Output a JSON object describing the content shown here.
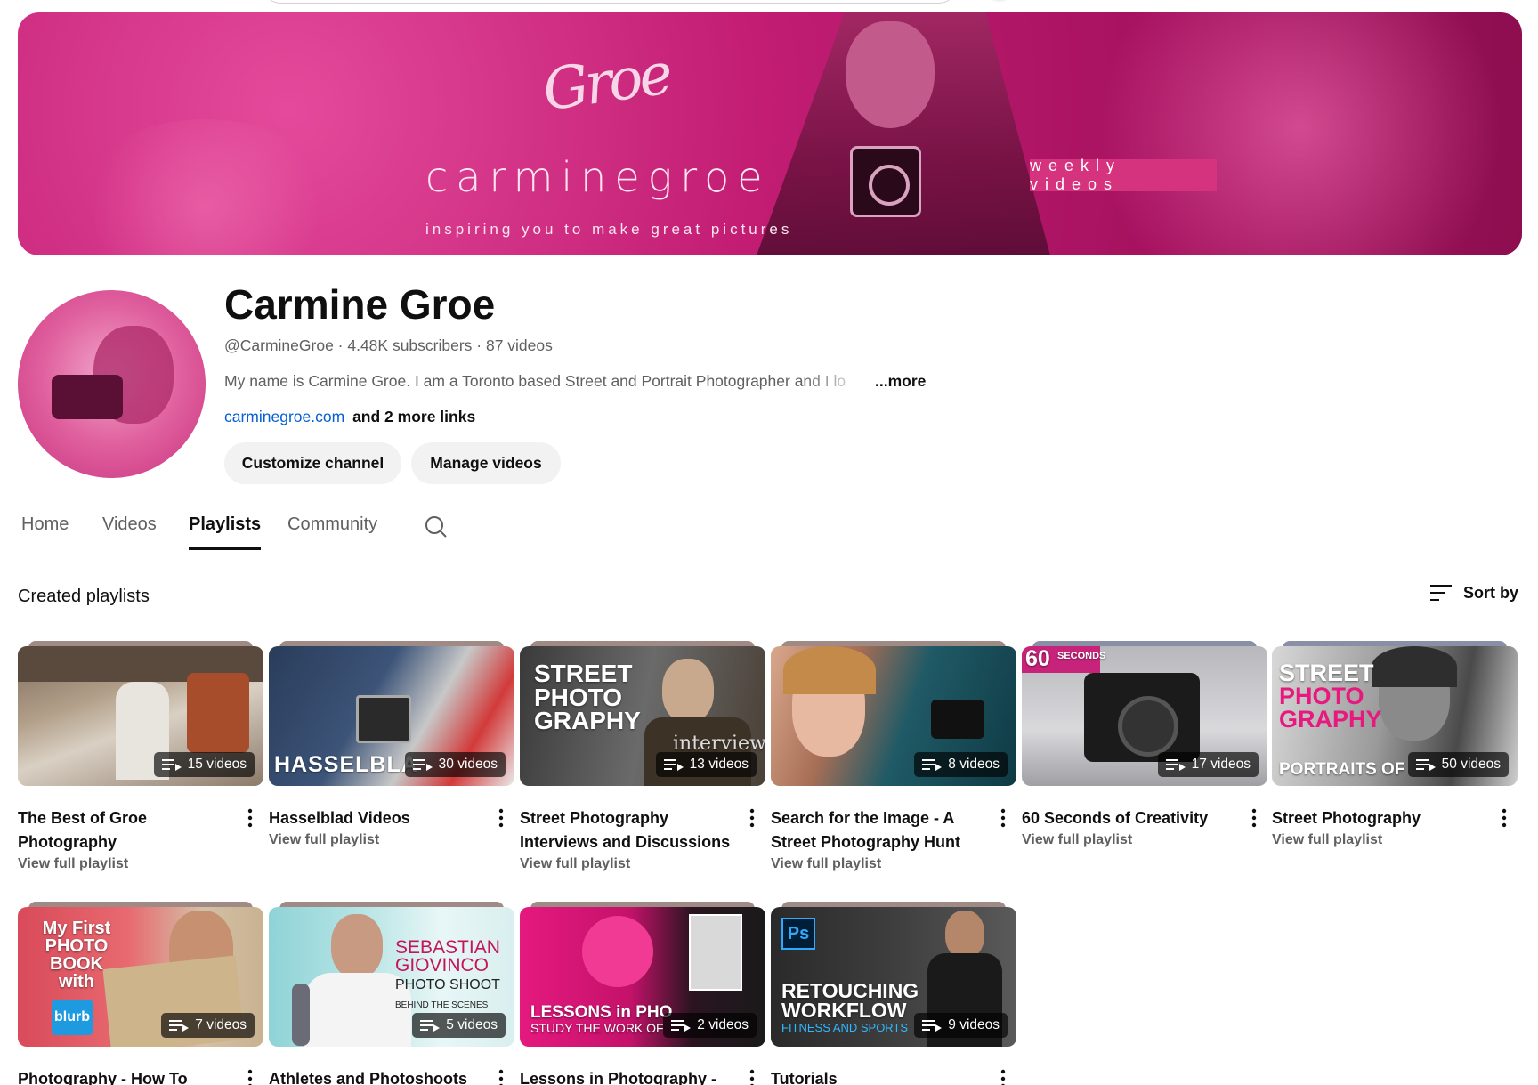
{
  "banner": {
    "signature": "Groe",
    "brand": "carminegroe",
    "tagline": "inspiring you to make great pictures",
    "badge": "weekly videos",
    "colors": {
      "primary": "#c21d73",
      "accent": "#d6337f"
    }
  },
  "channel": {
    "name": "Carmine Groe",
    "meta": "@CarmineGroe · 4.48K subscribers · 87 videos",
    "description": "My name is Carmine Groe. I am a Toronto based Street and Portrait Photographer and I lo",
    "more": "...more",
    "link": "carminegroe.com",
    "more_links": "and 2 more links",
    "customize_label": "Customize channel",
    "manage_label": "Manage videos"
  },
  "tabs": [
    {
      "label": "Home"
    },
    {
      "label": "Videos"
    },
    {
      "label": "Playlists",
      "active": true
    },
    {
      "label": "Community"
    }
  ],
  "section": {
    "title": "Created playlists",
    "sort_label": "Sort by"
  },
  "playlists": [
    {
      "title": "The Best of Groe Photography",
      "count": "15 videos",
      "link": "View full playlist"
    },
    {
      "title": "Hasselblad Videos",
      "count": "30 videos",
      "link": "View full playlist",
      "overlay": "HASSELBLA"
    },
    {
      "title": "Street Photography Interviews and Discussions",
      "count": "13 videos",
      "link": "View full playlist",
      "overlay": "STREET PHOTO GRAPHY",
      "overlay2": "interview"
    },
    {
      "title": "Search for the Image - A Street Photography Hunt",
      "count": "8 videos",
      "link": "View full playlist"
    },
    {
      "title": "60 Seconds of Creativity",
      "count": "17 videos",
      "link": "View full playlist",
      "overlay": "60",
      "overlay2": "SECONDS"
    },
    {
      "title": "Street Photography",
      "count": "50 videos",
      "link": "View full playlist",
      "overlay": "STREET",
      "overlay2": "PHOTO",
      "overlay3": "GRAPHY",
      "overlay4": "PORTRAITS OF"
    },
    {
      "title": "Photography - How To",
      "count": "7 videos",
      "overlay": "My First PHOTO BOOK with",
      "overlay2": "blurb"
    },
    {
      "title": "Athletes and Photoshoots",
      "count": "5 videos",
      "overlay": "SEBASTIAN GIOVINCO",
      "overlay2": "PHOTO SHOOT",
      "overlay3": "BEHIND THE SCENES"
    },
    {
      "title": "Lessons in Photography -",
      "count": "2 videos",
      "overlay": "LESSONS in PHO",
      "overlay2": "STUDY THE WORK OF"
    },
    {
      "title": "Tutorials",
      "count": "9 videos",
      "overlay": "Ps",
      "overlay2": "RETOUCHING WORKFLOW",
      "overlay3": "FITNESS AND SPORTS"
    }
  ]
}
